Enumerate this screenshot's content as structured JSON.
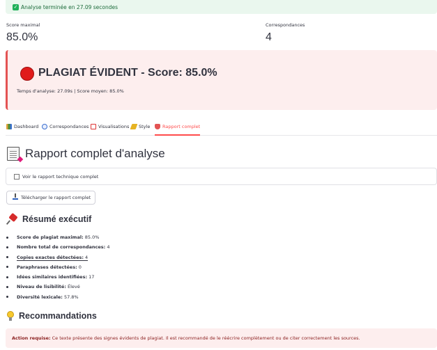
{
  "status": {
    "message": "Analyse terminée en 27.09 secondes",
    "color": "#21b15a"
  },
  "metrics": [
    {
      "label": "Score maximal",
      "value": "85.0%"
    },
    {
      "label": "Correspondances",
      "value": "4"
    }
  ],
  "verdict": {
    "icon": "red-circle-icon",
    "title": "PLAGIAT ÉVIDENT - Score: 85.0%",
    "details": "Temps d'analyse: 27.09s | Score moyen: 85.0%",
    "color": "#e35353"
  },
  "tabs": [
    {
      "label": "Dashboard",
      "icon": "bar-chart-icon",
      "active": false
    },
    {
      "label": "Correspondances",
      "icon": "magnifier-icon",
      "active": false
    },
    {
      "label": "Visualisations",
      "icon": "chart-icon",
      "active": false
    },
    {
      "label": "Style",
      "icon": "pen-icon",
      "active": false
    },
    {
      "label": "Rapport complet",
      "icon": "shield-icon",
      "active": true
    }
  ],
  "report": {
    "heading": "Rapport complet d'analyse",
    "expander_label": "Voir le rapport technique complet",
    "download_label": "Télécharger le rapport complet"
  },
  "summary": {
    "heading": "Résumé exécutif",
    "items": [
      {
        "label": "Score de plagiat maximal:",
        "value": " 85.0%"
      },
      {
        "label": "Nombre total de correspondances:",
        "value": " 4"
      },
      {
        "label": "Copies exactes détectées:",
        "value": " 4"
      },
      {
        "label": "Paraphrases détectées:",
        "value": " 0"
      },
      {
        "label": "Idées similaires identifiées:",
        "value": " 17"
      },
      {
        "label": "Niveau de lisibilité:",
        "value": " Élevé"
      },
      {
        "label": "Diversité lexicale:",
        "value": " 57.8%"
      }
    ]
  },
  "recommendations": {
    "heading": "Recommandations",
    "action_label": "Action requise:",
    "action_text": " Ce texte présente des signes évidents de plagiat. Il est recommandé de le réécrire complètement ou de citer correctement les sources."
  },
  "accent_color": "#ff4b4b"
}
